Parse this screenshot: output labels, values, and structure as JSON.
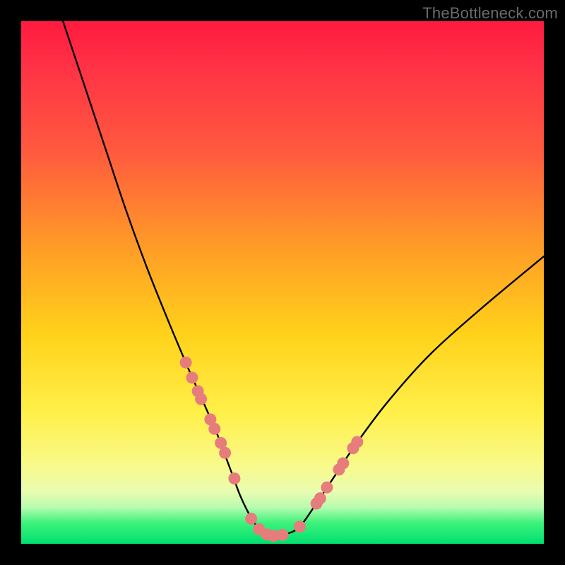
{
  "watermark": "TheBottleneck.com",
  "colors": {
    "frame": "#000000",
    "curve": "#000000",
    "marker_fill": "#e77c7c",
    "marker_stroke": "#cc5f5f"
  },
  "chart_data": {
    "type": "line",
    "title": "",
    "xlabel": "",
    "ylabel": "",
    "xlim": [
      0,
      100
    ],
    "ylim": [
      0,
      100
    ],
    "grid": false,
    "legend": false,
    "series": [
      {
        "name": "bottleneck-curve",
        "x": [
          8,
          12,
          16,
          20,
          24,
          28,
          32,
          34,
          36,
          37.5,
          39,
          40.5,
          42,
          44,
          46,
          48,
          50,
          53,
          56,
          60,
          64,
          70,
          78,
          88,
          100
        ],
        "values": [
          100,
          88,
          76,
          64,
          53,
          43,
          33.5,
          29,
          24.5,
          21,
          17,
          13,
          9,
          5,
          2.3,
          1.5,
          1.7,
          3,
          7,
          13,
          19,
          27,
          36,
          45,
          55
        ]
      }
    ],
    "markers": {
      "name": "highlight-points",
      "x": [
        31.5,
        32.7,
        33.8,
        34.4,
        36.2,
        37.0,
        38.2,
        39.0,
        40.8,
        44.0,
        45.5,
        47.0,
        48.3,
        50.0,
        53.3,
        56.5,
        57.2,
        58.5,
        60.8,
        61.6,
        63.5,
        64.3
      ],
      "values": [
        34.7,
        31.8,
        29.2,
        27.7,
        23.8,
        22.0,
        19.3,
        17.4,
        12.5,
        4.8,
        2.8,
        1.8,
        1.5,
        1.7,
        3.3,
        7.7,
        8.7,
        10.8,
        14.2,
        15.4,
        18.3,
        19.5
      ]
    }
  }
}
